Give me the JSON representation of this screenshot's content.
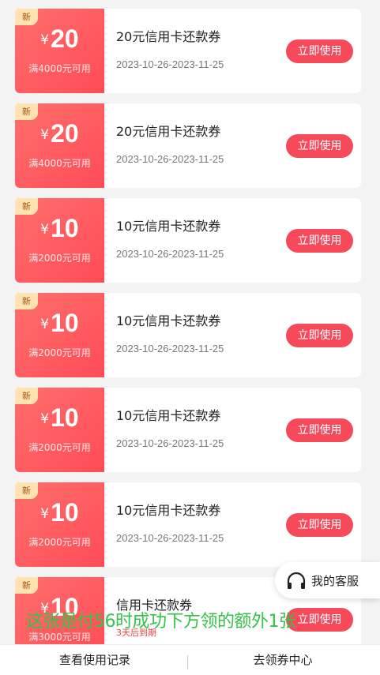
{
  "coupons": [
    {
      "new_tag": "新",
      "currency": "¥",
      "amount": "20",
      "condition": "满4000元可用",
      "title": "20元信用卡还款券",
      "date": "2023-10-26-2023-11-25",
      "button": "立即使用"
    },
    {
      "new_tag": "新",
      "currency": "¥",
      "amount": "20",
      "condition": "满4000元可用",
      "title": "20元信用卡还款券",
      "date": "2023-10-26-2023-11-25",
      "button": "立即使用"
    },
    {
      "new_tag": "新",
      "currency": "¥",
      "amount": "10",
      "condition": "满2000元可用",
      "title": "10元信用卡还款券",
      "date": "2023-10-26-2023-11-25",
      "button": "立即使用"
    },
    {
      "new_tag": "新",
      "currency": "¥",
      "amount": "10",
      "condition": "满2000元可用",
      "title": "10元信用卡还款券",
      "date": "2023-10-26-2023-11-25",
      "button": "立即使用"
    },
    {
      "new_tag": "新",
      "currency": "¥",
      "amount": "10",
      "condition": "满2000元可用",
      "title": "10元信用卡还款券",
      "date": "2023-10-26-2023-11-25",
      "button": "立即使用"
    },
    {
      "new_tag": "新",
      "currency": "¥",
      "amount": "10",
      "condition": "满2000元可用",
      "title": "10元信用卡还款券",
      "date": "2023-10-26-2023-11-25",
      "button": "立即使用"
    },
    {
      "new_tag": "新",
      "currency": "¥",
      "amount": "10",
      "condition": "满3000元可用",
      "title": "信用卡还款券",
      "expire_note": "3天后到期",
      "button": "立即使用"
    }
  ],
  "service": {
    "label": "我的客服",
    "icon": "headset-icon"
  },
  "overlay_caption": "这张是付56时成功下方领的额外1张",
  "bottom_bar": {
    "left_tab": "查看使用记录",
    "right_tab": "去领券中心"
  },
  "colors": {
    "accent": "#f6495a",
    "coupon_gradient_start": "#ff6e6c",
    "coupon_gradient_end": "#ff4c57",
    "new_tag_bg": "#ffe2b1",
    "overlay_text": "#34c24a"
  }
}
